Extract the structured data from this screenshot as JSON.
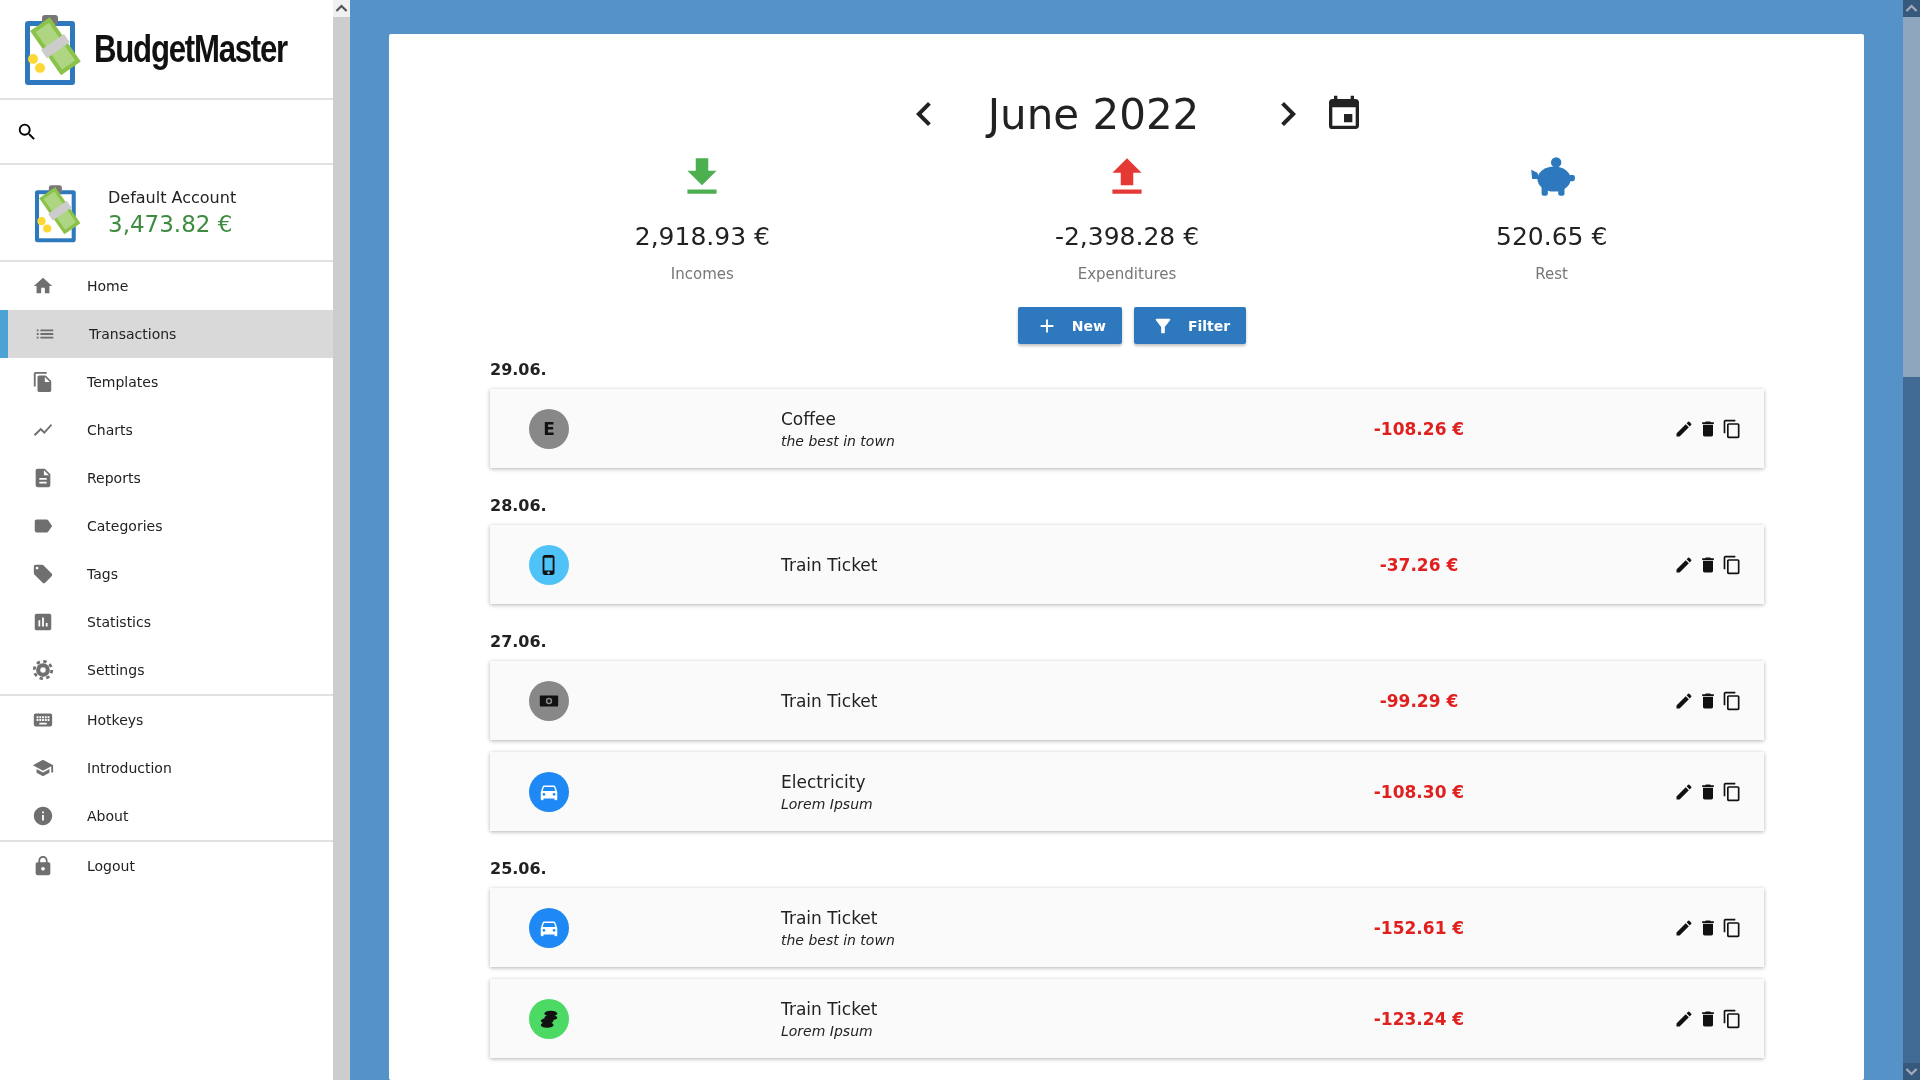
{
  "app": {
    "name": "BudgetMaster"
  },
  "account": {
    "name": "Default Account",
    "balance": "3,473.82 €"
  },
  "menu_sections": [
    [
      {
        "label": "Home",
        "selected": false
      },
      {
        "label": "Transactions",
        "selected": true
      },
      {
        "label": "Templates",
        "selected": false
      },
      {
        "label": "Charts",
        "selected": false
      },
      {
        "label": "Reports",
        "selected": false
      },
      {
        "label": "Categories",
        "selected": false
      },
      {
        "label": "Tags",
        "selected": false
      },
      {
        "label": "Statistics",
        "selected": false
      },
      {
        "label": "Settings",
        "selected": false
      }
    ],
    [
      {
        "label": "Hotkeys",
        "selected": false
      },
      {
        "label": "Introduction",
        "selected": false
      },
      {
        "label": "About",
        "selected": false
      }
    ],
    [
      {
        "label": "Logout",
        "selected": false
      }
    ]
  ],
  "month": {
    "title": "June 2022"
  },
  "summary": [
    {
      "kind": "income",
      "amount": "2,918.93 €",
      "label": "Incomes"
    },
    {
      "kind": "expenditure",
      "amount": "-2,398.28 €",
      "label": "Expenditures"
    },
    {
      "kind": "rest",
      "amount": "520.65 €",
      "label": "Rest"
    }
  ],
  "buttons": [
    {
      "kind": "new",
      "label": "New"
    },
    {
      "kind": "filter",
      "label": "Filter"
    }
  ],
  "days": [
    {
      "date": "29.06.",
      "transactions": [
        {
          "icon": {
            "kind": "letter",
            "letter": "E",
            "color": "#888888"
          },
          "name": "Coffee",
          "description": "the best in town",
          "amount": "-108.26 €"
        }
      ]
    },
    {
      "date": "28.06.",
      "transactions": [
        {
          "icon": {
            "kind": "phone",
            "color": "#4fc3f7"
          },
          "name": "Train Ticket",
          "amount": "-37.26 €"
        }
      ]
    },
    {
      "date": "27.06.",
      "transactions": [
        {
          "icon": {
            "kind": "cash",
            "color": "#888888"
          },
          "name": "Train Ticket",
          "amount": "-99.29 €"
        },
        {
          "icon": {
            "kind": "car",
            "color": "#1e88f5"
          },
          "name": "Electricity",
          "description": "Lorem Ipsum",
          "amount": "-108.30 €"
        }
      ]
    },
    {
      "date": "25.06.",
      "transactions": [
        {
          "icon": {
            "kind": "car",
            "color": "#1e88f5"
          },
          "name": "Train Ticket",
          "description": "the best in town",
          "amount": "-152.61 €"
        },
        {
          "icon": {
            "kind": "coins",
            "color": "#4cd964"
          },
          "name": "Train Ticket",
          "description": "Lorem Ipsum",
          "amount": "-123.24 €"
        }
      ]
    }
  ]
}
